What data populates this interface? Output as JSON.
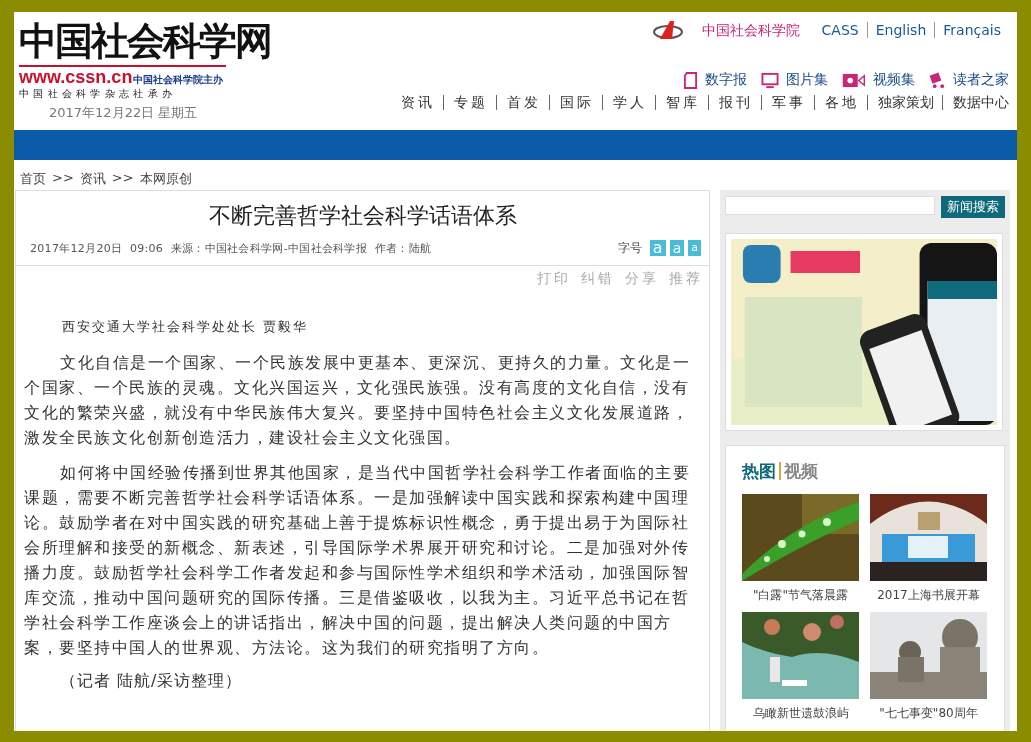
{
  "logo": {
    "title": "中国社会科学网",
    "url": "www.cssn.cn",
    "sponsor": "中国社会科学院主办",
    "publisher": "中国社会科学杂志社承办"
  },
  "date": "2017年12月22日 星期五",
  "top_links": [
    {
      "label": "中国社会科学院",
      "kind": "brand"
    },
    {
      "label": "CASS",
      "kind": "plain"
    },
    {
      "label": "English",
      "kind": "plain"
    },
    {
      "label": "Français",
      "kind": "plain"
    }
  ],
  "channel_links": [
    {
      "label": "数字报",
      "kind": "paper"
    },
    {
      "label": "图片集",
      "kind": "monitor"
    },
    {
      "label": "视频集",
      "kind": "video"
    },
    {
      "label": "读者之家",
      "kind": "cart"
    }
  ],
  "nav": [
    "资讯",
    "专题",
    "首发",
    "国际",
    "学人",
    "智库",
    "报刊",
    "军事",
    "各地",
    "独家策划",
    "数据中心"
  ],
  "breadcrumb": {
    "separator": ">>",
    "items": [
      "首页",
      "资讯",
      "本网原创"
    ]
  },
  "article": {
    "title": "不断完善哲学社会科学话语体系",
    "meta": "2017年12月20日  09:06  来源：中国社会科学网-中国社会科学报  作者：陆航",
    "font_size_label": "字号",
    "font_sizes": [
      {
        "label": "a",
        "kind": "large"
      },
      {
        "label": "a",
        "kind": "medium"
      },
      {
        "label": "a",
        "kind": "small"
      }
    ],
    "tools": [
      "打印",
      "纠错",
      "分享",
      "推荐"
    ],
    "byline": "西安交通大学社会科学处处长 贾毅华",
    "paragraphs": [
      "文化自信是一个国家、一个民族发展中更基本、更深沉、更持久的力量。文化是一个国家、一个民族的灵魂。文化兴国运兴，文化强民族强。没有高度的文化自信，没有文化的繁荣兴盛，就没有中华民族伟大复兴。要坚持中国特色社会主义文化发展道路，激发全民族文化创新创造活力，建设社会主义文化强国。",
      "如何将中国经验传播到世界其他国家，是当代中国哲学社会科学工作者面临的主要课题，需要不断完善哲学社会科学话语体系。一是加强解读中国实践和探索构建中国理论。鼓励学者在对中国实践的研究基础上善于提炼标识性概念，勇于提出易于为国际社会所理解和接受的新概念、新表述，引导国际学术界展开研究和讨论。二是加强对外传播力度。鼓励哲学社会科学工作者发起和参与国际性学术组织和学术活动，加强国际智库交流，推动中国问题研究的国际传播。三是借鉴吸收，以我为主。习近平总书记在哲学社会科学工作座谈会上的讲话指出，解决中国的问题，提出解决人类问题的中国方案，要坚持中国人的世界观、方法论。这为我们的研究指明了方向。"
    ],
    "closing": "（记者 陆航/采访整理）"
  },
  "sidebar": {
    "search_button": "新闻搜索",
    "media_tabs": [
      {
        "label": "热图",
        "selected": true
      },
      {
        "label": "视频",
        "selected": false
      }
    ],
    "gallery": [
      {
        "caption": "\"白露\"节气落晨露"
      },
      {
        "caption": "2017上海书展开幕"
      },
      {
        "caption": "乌瞰新世遗鼓浪屿"
      },
      {
        "caption": "\"七七事变\"80周年"
      }
    ]
  }
}
